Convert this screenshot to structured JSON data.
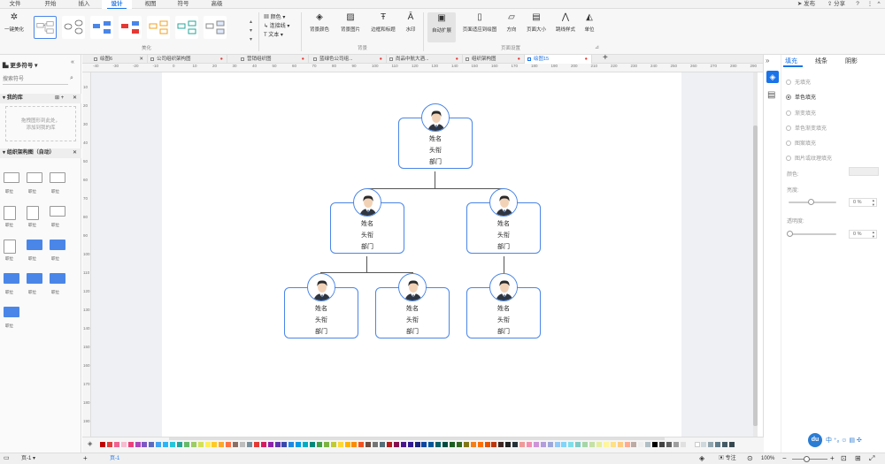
{
  "menu": {
    "tabs": [
      "文件",
      "开始",
      "插入",
      "设计",
      "视图",
      "符号",
      "高级"
    ],
    "active_tab": "设计",
    "right_items": [
      "发布",
      "分享"
    ]
  },
  "ribbon": {
    "beautify_label": "一键美化",
    "beautify_group": "美化",
    "format_items": [
      "颜色",
      "连接线",
      "文本"
    ],
    "background_buttons": [
      "背景颜色",
      "背景图片",
      "边框和标题",
      "水印"
    ],
    "background_group": "背景",
    "page_buttons": [
      "自动扩展",
      "页面适应到绘图",
      "方向",
      "页面大小",
      "跳线样式",
      "单位"
    ],
    "page_group": "页面设置"
  },
  "left_panel": {
    "title": "更多符号",
    "search_placeholder": "搜索符号",
    "my_library": "我的库",
    "drop_hint_1": "拖拽图形到此处，",
    "drop_hint_2": "添加到我的库",
    "org_library": "组织架构图（自动）",
    "shape_label": "职位"
  },
  "doc_tabs": [
    "绘图6",
    "公司组织架构图",
    "营销组织图",
    "蓝绿色公司组...",
    "尚品中航大酒...",
    "组织架构图",
    "绘图15"
  ],
  "active_doc_tab": "绘图15",
  "ruler_h": [
    "-40",
    "-30",
    "-20",
    "-10",
    "0",
    "10",
    "20",
    "30",
    "40",
    "50",
    "60",
    "70",
    "80",
    "90",
    "100",
    "110",
    "120",
    "130",
    "140",
    "150",
    "160",
    "170",
    "180",
    "190",
    "200",
    "210",
    "220",
    "230",
    "240",
    "250",
    "260",
    "270",
    "280",
    "290"
  ],
  "ruler_v": [
    "10",
    "20",
    "30",
    "40",
    "50",
    "60",
    "70",
    "80",
    "90",
    "100",
    "110",
    "120",
    "130",
    "140",
    "150",
    "160",
    "170",
    "180",
    "190"
  ],
  "org_nodes": [
    {
      "name": "姓名",
      "title": "头衔",
      "dept": "部门"
    },
    {
      "name": "姓名",
      "title": "头衔",
      "dept": "部门"
    },
    {
      "name": "姓名",
      "title": "头衔",
      "dept": "部门"
    },
    {
      "name": "姓名",
      "title": "头衔",
      "dept": "部门"
    },
    {
      "name": "姓名",
      "title": "头衔",
      "dept": "部门"
    },
    {
      "name": "姓名",
      "title": "头衔",
      "dept": "部门"
    }
  ],
  "right_panel": {
    "tabs": [
      "填充",
      "线条",
      "阴影"
    ],
    "active_tab": "填充",
    "fill_options": [
      "无填充",
      "单色填充",
      "渐变填充",
      "单色渐变填充",
      "图案填充",
      "图片或纹理填充"
    ],
    "selected_fill": "单色填充",
    "color_label": "颜色:",
    "brightness_label": "亮度:",
    "transparency_label": "透明度:",
    "brightness_value": "0 %",
    "transparency_value": "0 %"
  },
  "palette": [
    "#c00000",
    "#e03e3e",
    "#f06292",
    "#f8bbd0",
    "#ec407a",
    "#ab47bc",
    "#7e57c2",
    "#5c6bc0",
    "#42a5f5",
    "#29b6f6",
    "#26c6da",
    "#26a69a",
    "#66bb6a",
    "#9ccc65",
    "#d4e157",
    "#ffee58",
    "#ffca28",
    "#ffa726",
    "#ff7043",
    "#8d6e63",
    "#bdbdbd",
    "#78909c",
    "#e53935",
    "#d81b60",
    "#8e24aa",
    "#5e35b1",
    "#3949ab",
    "#1e88e5",
    "#039be5",
    "#00acc1",
    "#00897b",
    "#43a047",
    "#7cb342",
    "#c0ca33",
    "#fdd835",
    "#ffb300",
    "#fb8c00",
    "#f4511e",
    "#6d4c41",
    "#757575",
    "#546e7a",
    "#b71c1c",
    "#880e4f",
    "#4a148c",
    "#311b92",
    "#1a237e",
    "#0d47a1",
    "#01579b",
    "#006064",
    "#004d40",
    "#1b5e20",
    "#33691e",
    "#827717",
    "#f57f17",
    "#ff6f00",
    "#e65100",
    "#bf360c",
    "#3e2723",
    "#212121",
    "#263238",
    "#ef9a9a",
    "#f48fb1",
    "#ce93d8",
    "#b39ddb",
    "#9fa8da",
    "#90caf9",
    "#81d4fa",
    "#80deea",
    "#80cbc4",
    "#a5d6a7",
    "#c5e1a5",
    "#e6ee9c",
    "#fff59d",
    "#ffe082",
    "#ffcc80",
    "#ffab91",
    "#bcaaa4",
    "#eeeeee",
    "#b0bec5",
    "#000000",
    "#424242",
    "#616161",
    "#9e9e9e",
    "#e0e0e0",
    "#f5f5f5",
    "#ffffff",
    "#cfd8dc",
    "#90a4ae",
    "#607d8b",
    "#455a64",
    "#37474f"
  ],
  "status": {
    "page_selector": "页-1",
    "page_tab": "页-1",
    "focus_label": "专注",
    "zoom": "100%"
  },
  "colors": {
    "accent": "#1a73e8",
    "node_border": "#4a86e8"
  }
}
